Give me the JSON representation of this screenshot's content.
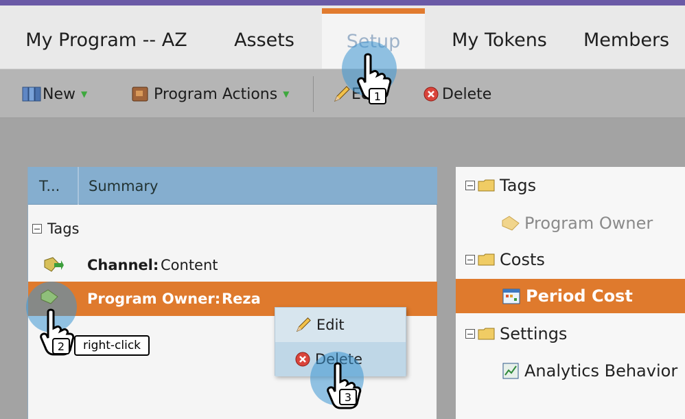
{
  "tabs": [
    {
      "label": "My Program -- AZ"
    },
    {
      "label": "Assets"
    },
    {
      "label": "Setup"
    },
    {
      "label": "My Tokens"
    },
    {
      "label": "Members"
    }
  ],
  "toolbar": {
    "new_label": "New",
    "program_actions_label": "Program Actions",
    "edit_label": "Edit",
    "delete_label": "Delete"
  },
  "grid": {
    "col_type": "T...",
    "col_summary": "Summary",
    "group_tags": "Tags",
    "rows": [
      {
        "key": "Channel:",
        "value": "Content"
      },
      {
        "key": "Program Owner:",
        "value": "Reza"
      }
    ]
  },
  "context_menu": {
    "edit_label": "Edit",
    "delete_label": "Delete"
  },
  "tree": {
    "tags_label": "Tags",
    "program_owner_label": "Program Owner",
    "costs_label": "Costs",
    "period_cost_label": "Period Cost",
    "settings_label": "Settings",
    "analytics_label": "Analytics Behavior"
  },
  "annotations": {
    "step1": "1",
    "step2": "2",
    "step3": "3",
    "right_click": "right-click"
  },
  "colors": {
    "accent_orange": "#df7a2d",
    "header_blue": "#85aecf",
    "top_purple": "#6a5aa6"
  }
}
